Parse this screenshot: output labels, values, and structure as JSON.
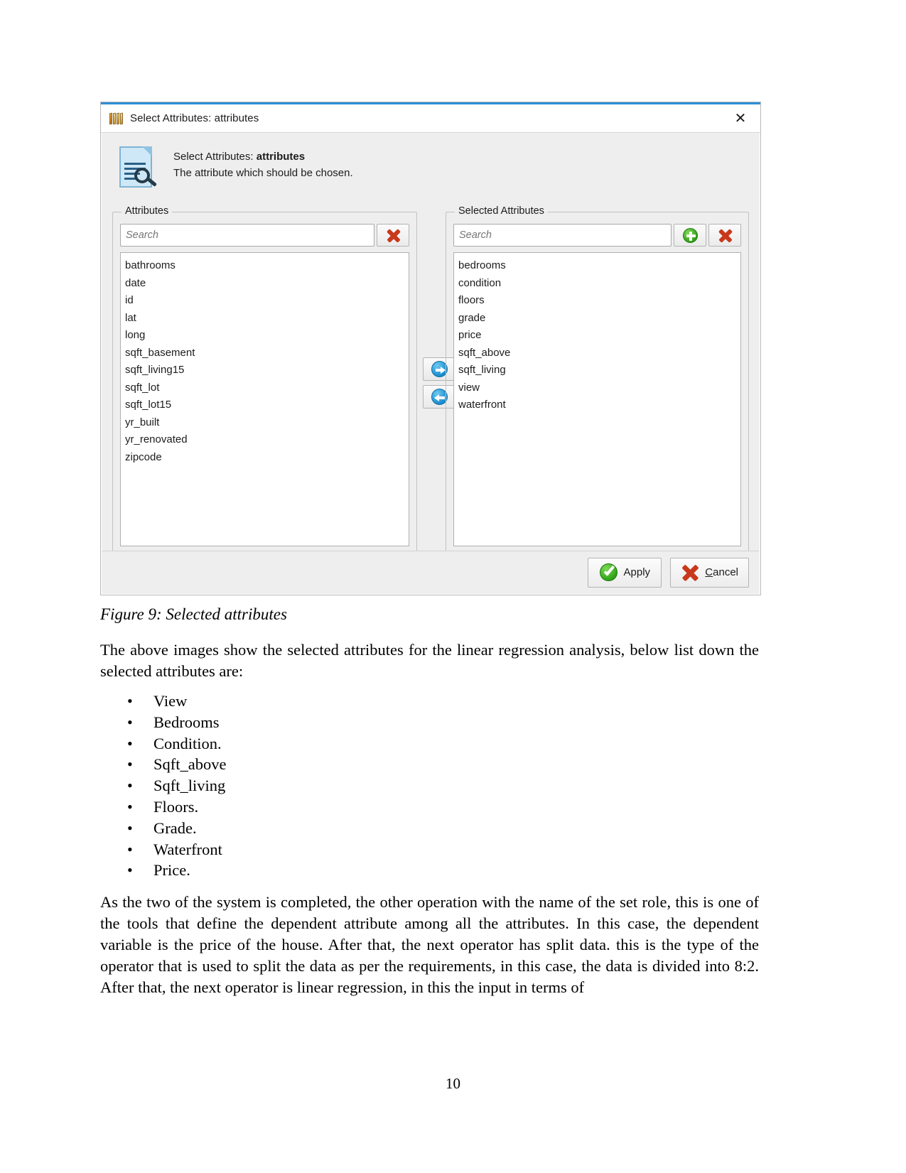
{
  "dialog": {
    "title": "Select Attributes: attributes",
    "close_label": "✕",
    "header": {
      "line1_prefix": "Select Attributes: ",
      "line1_bold": "attributes",
      "line2": "The attribute which should be chosen."
    },
    "left_panel": {
      "legend": "Attributes",
      "search_placeholder": "Search",
      "search_value": "",
      "clear_button_title": "Clear",
      "items": [
        "bathrooms",
        "date",
        "id",
        "lat",
        "long",
        "sqft_basement",
        "sqft_living15",
        "sqft_lot",
        "sqft_lot15",
        "yr_built",
        "yr_renovated",
        "zipcode"
      ]
    },
    "right_panel": {
      "legend": "Selected Attributes",
      "search_placeholder": "Search",
      "search_value": "",
      "add_button_title": "Add",
      "clear_button_title": "Clear",
      "items": [
        "bedrooms",
        "condition",
        "floors",
        "grade",
        "price",
        "sqft_above",
        "sqft_living",
        "view",
        "waterfront"
      ]
    },
    "transfer": {
      "to_right_title": "Move to selected",
      "to_left_title": "Move to available"
    },
    "footer": {
      "apply_label": "Apply",
      "cancel_mnemonic": "C",
      "cancel_rest": "ancel"
    },
    "colors": {
      "accent_blue": "#2d8fd5",
      "icon_red": "#c8391b",
      "icon_green": "#2f9c18",
      "icon_blue": "#1287c9"
    }
  },
  "document": {
    "caption": "Figure 9: Selected attributes",
    "paragraph1": "The above images show the selected attributes for the linear regression analysis, below list down the selected attributes are:",
    "bullets": [
      "View",
      "Bedrooms",
      "Condition.",
      "Sqft_above",
      "Sqft_living",
      "Floors.",
      "Grade.",
      "Waterfront",
      "Price."
    ],
    "paragraph2": "As the two of the system is completed, the other operation with the name of the set role, this is one of the tools that define the dependent attribute among all the attributes. In this case, the dependent variable is the price of the house. After that, the next operator has split data. this is the type of the operator that is used to split the data as per the requirements, in this case, the data is divided into 8:2.  After that, the next operator is linear regression, in this the input in terms of",
    "page_number": "10"
  }
}
